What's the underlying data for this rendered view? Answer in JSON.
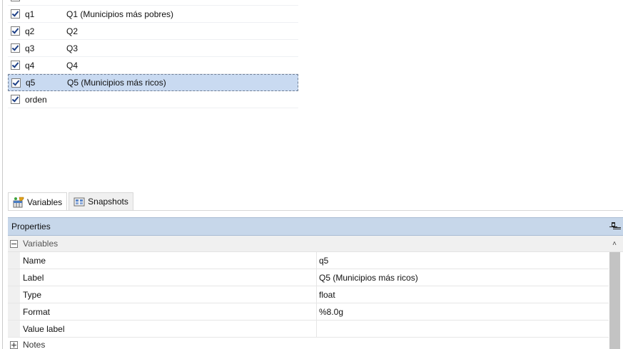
{
  "variables_list": [
    {
      "name": "q1",
      "label": "Q1 (Municipios más pobres)",
      "checked": true,
      "selected": false
    },
    {
      "name": "q2",
      "label": "Q2",
      "checked": true,
      "selected": false
    },
    {
      "name": "q3",
      "label": "Q3",
      "checked": true,
      "selected": false
    },
    {
      "name": "q4",
      "label": "Q4",
      "checked": true,
      "selected": false
    },
    {
      "name": "q5",
      "label": "Q5 (Municipios más ricos)",
      "checked": true,
      "selected": true
    },
    {
      "name": "orden",
      "label": "",
      "checked": true,
      "selected": false
    }
  ],
  "tabs": [
    {
      "label": "Variables",
      "icon": "variables-icon",
      "active": true
    },
    {
      "label": "Snapshots",
      "icon": "snapshots-icon",
      "active": false
    }
  ],
  "properties": {
    "title": "Properties",
    "group": "Variables",
    "rows": [
      {
        "name": "Name",
        "value": "q5"
      },
      {
        "name": "Label",
        "value": "Q5 (Municipios más ricos)"
      },
      {
        "name": "Type",
        "value": "float"
      },
      {
        "name": "Format",
        "value": "%8.0g"
      },
      {
        "name": "Value label",
        "value": ""
      }
    ],
    "notes_label": "Notes"
  },
  "colors": {
    "selection": "#c9daf1",
    "header": "#c7d7ea",
    "checkmark": "#1d3f86"
  }
}
